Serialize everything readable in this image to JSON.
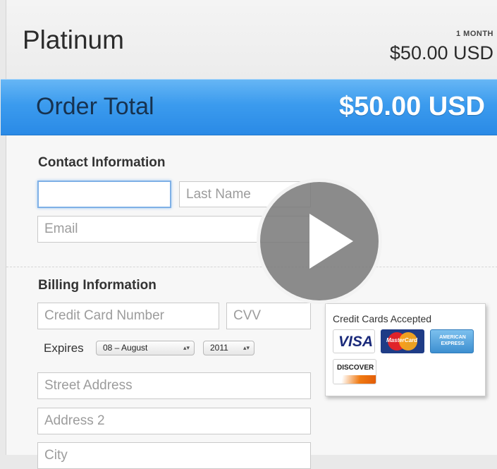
{
  "plan": {
    "name": "Platinum",
    "period": "1 MONTH",
    "price": "$50.00 USD"
  },
  "order_total": {
    "label": "Order Total",
    "value": "$50.00 USD"
  },
  "contact": {
    "title": "Contact Information",
    "first_name": {
      "value": "",
      "placeholder": ""
    },
    "last_name": {
      "value": "",
      "placeholder": "Last Name"
    },
    "email": {
      "value": "",
      "placeholder": "Email"
    }
  },
  "billing": {
    "title": "Billing Information",
    "card_number": {
      "placeholder": "Credit Card Number"
    },
    "cvv": {
      "placeholder": "CVV"
    },
    "expires_label": "Expires",
    "month_selected": "08 – August",
    "year_selected": "2011",
    "street": {
      "placeholder": "Street Address"
    },
    "address2": {
      "placeholder": "Address 2"
    },
    "city": {
      "placeholder": "City"
    }
  },
  "cards_accepted": {
    "title": "Credit Cards Accepted",
    "cards": [
      {
        "name": "visa-icon",
        "label": "VISA"
      },
      {
        "name": "mastercard-icon",
        "label": "MasterCard"
      },
      {
        "name": "amex-icon",
        "label": "AMERICAN EXPRESS"
      },
      {
        "name": "discover-icon",
        "label": "DISCOVER"
      }
    ]
  },
  "video": {
    "icon": "play-icon"
  },
  "colors": {
    "accent_blue": "#3b9bee",
    "total_text": "#17324f"
  }
}
